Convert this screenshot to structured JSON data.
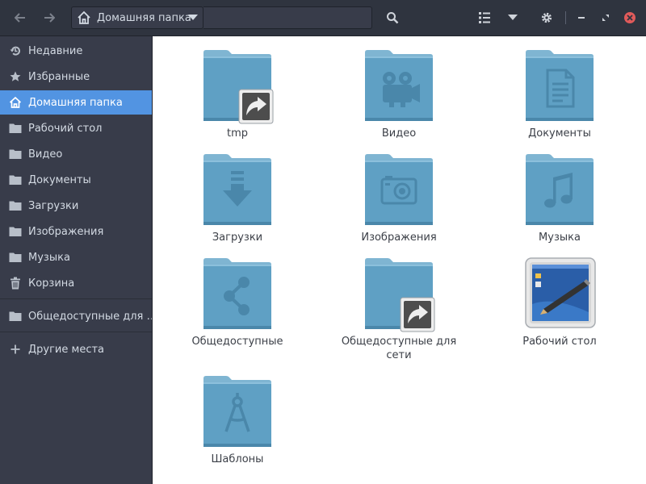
{
  "header": {
    "back_icon": "back-arrow-icon",
    "forward_icon": "forward-arrow-icon",
    "location": "Домашняя папка",
    "search_icon": "search-icon",
    "view_icon": "list-view-icon",
    "menu_icon": "chevron-down-icon",
    "settings_icon": "gear-icon",
    "window_controls": [
      "minimize-icon",
      "restore-icon",
      "close-icon"
    ]
  },
  "sidebar": {
    "items": [
      {
        "label": "Недавние",
        "icon": "recent-icon"
      },
      {
        "label": "Избранные",
        "icon": "star-icon"
      },
      {
        "label": "Домашняя папка",
        "icon": "home-icon",
        "active": true
      },
      {
        "label": "Рабочий стол",
        "icon": "folder-icon"
      },
      {
        "label": "Видео",
        "icon": "folder-icon"
      },
      {
        "label": "Документы",
        "icon": "folder-icon"
      },
      {
        "label": "Загрузки",
        "icon": "folder-icon"
      },
      {
        "label": "Изображения",
        "icon": "folder-icon"
      },
      {
        "label": "Музыка",
        "icon": "folder-icon"
      },
      {
        "label": "Корзина",
        "icon": "trash-icon"
      },
      {
        "label": "Общедоступные для …",
        "icon": "folder-icon"
      },
      {
        "label": "Другие места",
        "icon": "plus-icon"
      }
    ]
  },
  "files": [
    {
      "name": "tmp",
      "icon": "folder-link-icon"
    },
    {
      "name": "Видео",
      "icon": "folder-video-icon"
    },
    {
      "name": "Документы",
      "icon": "folder-documents-icon"
    },
    {
      "name": "Загрузки",
      "icon": "folder-download-icon"
    },
    {
      "name": "Изображения",
      "icon": "folder-pictures-icon"
    },
    {
      "name": "Музыка",
      "icon": "folder-music-icon"
    },
    {
      "name": "Общедоступные",
      "icon": "folder-share-icon"
    },
    {
      "name": "Общедоступные для сети",
      "icon": "folder-link-icon"
    },
    {
      "name": "Рабочий стол",
      "icon": "desktop-icon"
    },
    {
      "name": "Шаблоны",
      "icon": "folder-templates-icon"
    }
  ],
  "colors": {
    "accent": "#5294e2",
    "sidebar_bg": "#383c4a",
    "header_bg": "#2f343f",
    "folder": "#5fa0c4",
    "close": "#e05a5a"
  }
}
